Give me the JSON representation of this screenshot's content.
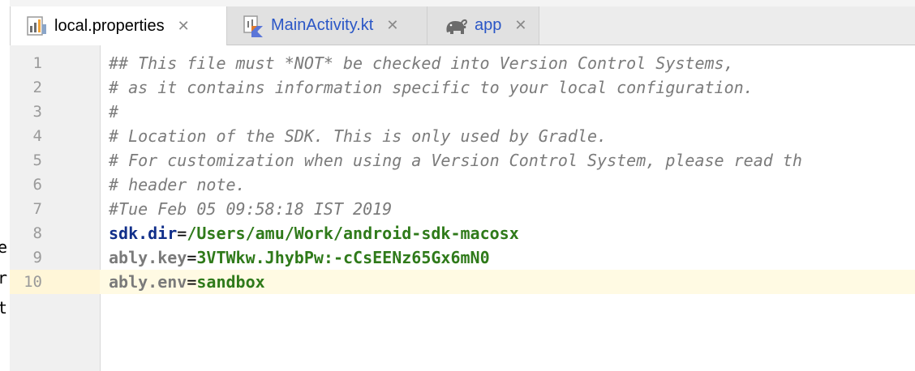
{
  "tabs": [
    {
      "label": "local.properties",
      "icon": "properties-file-icon",
      "active": true
    },
    {
      "label": "MainActivity.kt",
      "icon": "kotlin-file-icon",
      "active": false
    },
    {
      "label": "app",
      "icon": "gradle-elephant-icon",
      "active": false
    }
  ],
  "close_glyph": "✕",
  "left_fragments": [
    "e",
    "r",
    "t"
  ],
  "editor": {
    "current_line": 10,
    "lines": [
      {
        "num": "1",
        "text": "## This file must *NOT* be checked into Version Control Systems,"
      },
      {
        "num": "2",
        "text": "# as it contains information specific to your local configuration."
      },
      {
        "num": "3",
        "text": "#"
      },
      {
        "num": "4",
        "text": "# Location of the SDK. This is only used by Gradle."
      },
      {
        "num": "5",
        "text": "# For customization when using a Version Control System, please read th"
      },
      {
        "num": "6",
        "text": "# header note."
      },
      {
        "num": "7",
        "text": "#Tue Feb 05 09:58:18 IST 2019"
      },
      {
        "num": "8",
        "key": "sdk.dir",
        "value": "/Users/amu/Work/android-sdk-macosx"
      },
      {
        "num": "9",
        "key": "ably.key",
        "value": "3VTWkw.JhybPw:-cCsEENz65Gx6mN0"
      },
      {
        "num": "10",
        "key": "ably.env",
        "value": "sandbox"
      }
    ],
    "equals": "="
  },
  "colors": {
    "comment": "#7b7b7b",
    "key_sdk": "#112f8a",
    "key_other": "#7a7a7a",
    "value": "#2f7a1a",
    "caret_line": "#fffae3",
    "tab_link": "#2a56c6"
  }
}
